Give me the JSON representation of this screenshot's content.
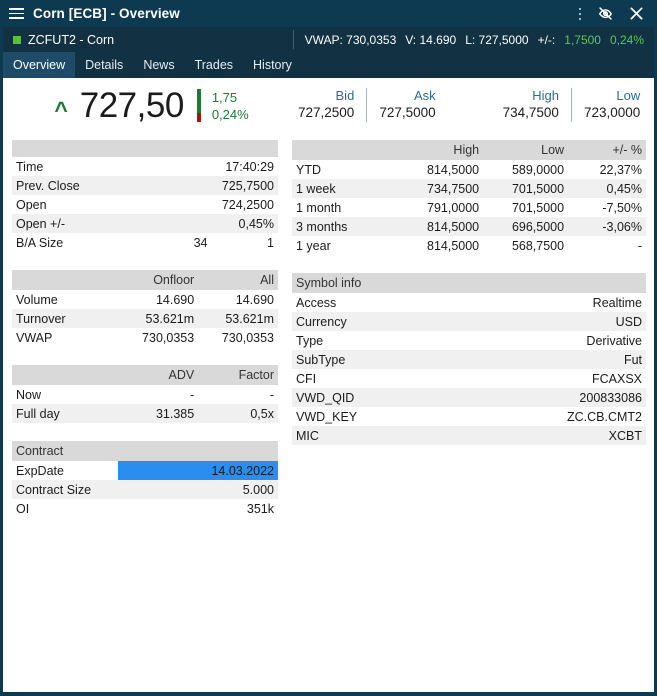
{
  "titlebar": {
    "title": "Corn [ECB] - Overview",
    "menu_icon": "hamburger-icon",
    "more_icon": "more-vertical-icon",
    "unlink_icon": "unlink-eye-slash-icon",
    "close_icon": "close-icon"
  },
  "symbolbar": {
    "symbol": "ZCFUT2 - Corn",
    "status_dot_color": "#55c23a",
    "vwap": "VWAP: 730,0353",
    "volume": "V: 14.690",
    "last": "L: 727,5000",
    "change_label": "+/-:",
    "change_abs": "1,7500",
    "change_pct": "0,24%"
  },
  "tabs": [
    {
      "label": "Overview",
      "active": true
    },
    {
      "label": "Details",
      "active": false
    },
    {
      "label": "News",
      "active": false
    },
    {
      "label": "Trades",
      "active": false
    },
    {
      "label": "History",
      "active": false
    }
  ],
  "price": {
    "direction_caret": "^",
    "last": "727,50",
    "change_abs": "1,75",
    "change_pct": "0,24%",
    "up_color": "#1c7a33",
    "down_color": "#aa1111"
  },
  "quotes": {
    "bid_label": "Bid",
    "bid_value": "727,2500",
    "ask_label": "Ask",
    "ask_value": "727,5000",
    "high_label": "High",
    "high_value": "734,7500",
    "low_label": "Low",
    "low_value": "723,0000"
  },
  "session_table": {
    "headers": [
      "",
      "",
      ""
    ],
    "rows": [
      {
        "label": "Time",
        "mid": "",
        "value": "17:40:29",
        "value_class": ""
      },
      {
        "label": "Prev. Close",
        "mid": "",
        "value": "725,7500",
        "value_class": ""
      },
      {
        "label": "Open",
        "mid": "",
        "value": "724,2500",
        "value_class": ""
      },
      {
        "label": "Open +/-",
        "mid": "",
        "value": "0,45%",
        "value_class": "pos"
      },
      {
        "label": "B/A Size",
        "mid": "34",
        "value": "1",
        "value_class": ""
      }
    ]
  },
  "volume_table": {
    "headers": [
      "",
      "Onfloor",
      "All"
    ],
    "rows": [
      {
        "label": "Volume",
        "mid": "14.690",
        "value": "14.690",
        "value_class": ""
      },
      {
        "label": "Turnover",
        "mid": "53.621m",
        "value": "53.621m",
        "value_class": ""
      },
      {
        "label": "VWAP",
        "mid": "730,0353",
        "value": "730,0353",
        "value_class": ""
      }
    ]
  },
  "adv_table": {
    "headers": [
      "",
      "ADV",
      "Factor"
    ],
    "rows": [
      {
        "label": "Now",
        "mid": "-",
        "value": "-",
        "value_class": ""
      },
      {
        "label": "Full day",
        "mid": "31.385",
        "value": "0,5x",
        "value_class": ""
      }
    ]
  },
  "contract_table": {
    "title": "Contract",
    "rows": [
      {
        "label": "ExpDate",
        "value": "14.03.2022",
        "value_class": "",
        "selected": true
      },
      {
        "label": "Contract Size",
        "value": "5.000",
        "value_class": "",
        "selected": false
      },
      {
        "label": "OI",
        "value": "351k",
        "value_class": "",
        "selected": false
      }
    ]
  },
  "performance_table": {
    "headers": [
      "",
      "High",
      "Low",
      "+/- %"
    ],
    "rows": [
      {
        "label": "YTD",
        "high": "814,5000",
        "low": "589,0000",
        "chg": "22,37%",
        "chg_class": "pos"
      },
      {
        "label": "1 week",
        "high": "734,7500",
        "low": "701,5000",
        "chg": "0,45%",
        "chg_class": "pos"
      },
      {
        "label": "1 month",
        "high": "791,0000",
        "low": "701,5000",
        "chg": "-7,50%",
        "chg_class": "neg"
      },
      {
        "label": "3 months",
        "high": "814,5000",
        "low": "696,5000",
        "chg": "-3,06%",
        "chg_class": "neg"
      },
      {
        "label": "1 year",
        "high": "814,5000",
        "low": "568,7500",
        "chg": "-",
        "chg_class": ""
      }
    ]
  },
  "symbol_info": {
    "title": "Symbol info",
    "rows": [
      {
        "label": "Access",
        "value": "Realtime"
      },
      {
        "label": "Currency",
        "value": "USD"
      },
      {
        "label": "Type",
        "value": "Derivative"
      },
      {
        "label": "SubType",
        "value": "Fut"
      },
      {
        "label": "CFI",
        "value": "FCAXSX"
      },
      {
        "label": "VWD_QID",
        "value": "200833086"
      },
      {
        "label": "VWD_KEY",
        "value": "ZC.CB.CMT2"
      },
      {
        "label": "MIC",
        "value": "XCBT"
      }
    ]
  },
  "colors": {
    "chrome": "#0d3a50",
    "chrome_light": "#123143",
    "tab_active": "#1d4b68",
    "accent_blue": "#2e6b91",
    "selection": "#2a8ef0",
    "positive": "#1c7a33",
    "negative": "#c0262b",
    "header_row": "#d9d9d9",
    "zebra_row": "#f0f0f0"
  }
}
